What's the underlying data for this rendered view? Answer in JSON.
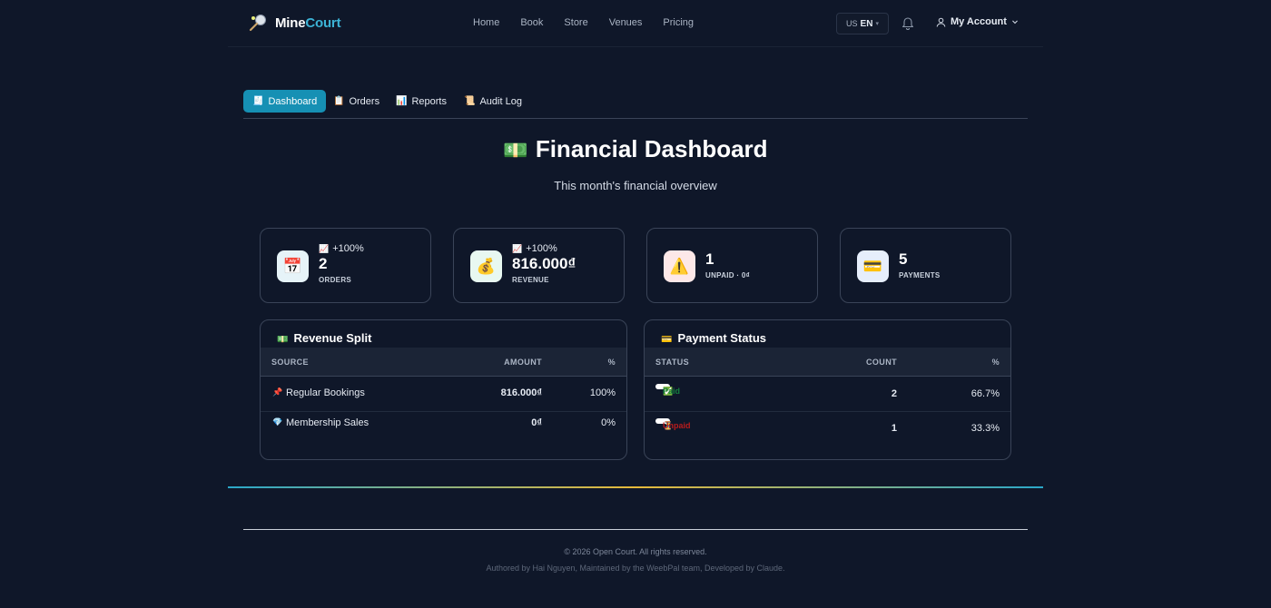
{
  "brand": {
    "part1": "Mine",
    "part2": "Court"
  },
  "nav": {
    "links": [
      "Home",
      "Book",
      "Store",
      "Venues",
      "Pricing"
    ]
  },
  "lang": {
    "flag": "US",
    "code": "EN"
  },
  "account": {
    "label": "My Account"
  },
  "tabs": [
    {
      "icon": "🧾",
      "label": "Dashboard",
      "active": true
    },
    {
      "icon": "📋",
      "label": "Orders"
    },
    {
      "icon": "📊",
      "label": "Reports"
    },
    {
      "icon": "📜",
      "label": "Audit Log"
    }
  ],
  "page": {
    "title_icon": "💵",
    "title": "Financial Dashboard",
    "subtitle": "This month's financial overview"
  },
  "stats": [
    {
      "icon": "📅",
      "trend_icon": "📈",
      "trend": "+100%",
      "value": "2",
      "label": "ORDERS",
      "icon_bg": "#e6f3f8"
    },
    {
      "icon": "💰",
      "trend_icon": "📈",
      "trend": "+100%",
      "value": "816.000₫",
      "label": "REVENUE",
      "icon_bg": "#e8f8f1"
    },
    {
      "icon": "⚠️",
      "value": "1",
      "label": "UNPAID · 0₫",
      "icon_bg": "#fde8e8"
    },
    {
      "icon": "💳",
      "value": "5",
      "label": "PAYMENTS",
      "icon_bg": "#e6eefb"
    }
  ],
  "revenue_split": {
    "icon": "💵",
    "title": "Revenue Split",
    "headers": {
      "source": "SOURCE",
      "amount": "AMOUNT",
      "pct": "%"
    },
    "rows": [
      {
        "icon": "📌",
        "source": "Regular Bookings",
        "amount": "816.000₫",
        "pct": "100%"
      },
      {
        "icon": "💎",
        "source": "Membership Sales",
        "amount": "0₫",
        "pct": "0%"
      }
    ]
  },
  "payment_status": {
    "icon": "💳",
    "title": "Payment Status",
    "headers": {
      "status": "STATUS",
      "count": "COUNT",
      "pct": "%"
    },
    "rows": [
      {
        "icon": "✅",
        "status": "Paid",
        "count": "2",
        "pct": "66.7%"
      },
      {
        "icon": "⏳",
        "status": "Unpaid",
        "count": "1",
        "pct": "33.3%"
      }
    ]
  },
  "footer": {
    "copyright": "© 2026 Open Court. All rights reserved.",
    "credit": "Authored by Hai Nguyen, Maintained by the WeebPal team, Developed by Claude."
  }
}
